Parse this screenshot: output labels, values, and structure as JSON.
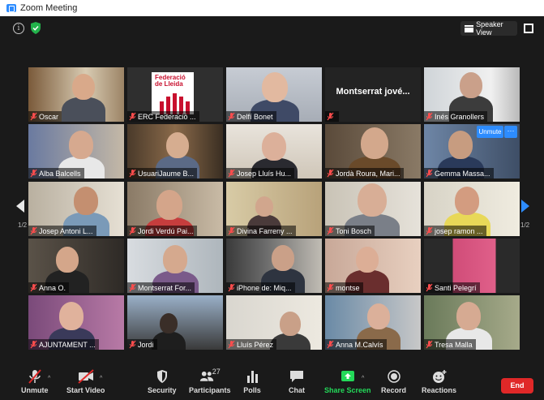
{
  "window": {
    "title": "Zoom Meeting"
  },
  "topbar": {
    "speaker_view_label": "Speaker View"
  },
  "pager": {
    "left_label": "1/2",
    "right_label": "1/2"
  },
  "tiles": [
    {
      "name": "Oscar"
    },
    {
      "name": "ERC Federació ..."
    },
    {
      "name": "Delfí Bonet"
    },
    {
      "name": "",
      "display_text": "Montserrat jové..."
    },
    {
      "name": "Inés Granollers"
    },
    {
      "name": "Alba Balcells"
    },
    {
      "name": "UsuariJaume B..."
    },
    {
      "name": "Josep Lluís Hu..."
    },
    {
      "name": "Jordà Roura, Mari..."
    },
    {
      "name": "Gemma Massa..."
    },
    {
      "name": "Josep Antoni L..."
    },
    {
      "name": "Jordi Verdú Pai..."
    },
    {
      "name": "Divina Farreny ..."
    },
    {
      "name": "Toni Bosch"
    },
    {
      "name": "josep ramon ..."
    },
    {
      "name": "Anna O."
    },
    {
      "name": "Montserrat For..."
    },
    {
      "name": "iPhone de: Miq..."
    },
    {
      "name": "montse"
    },
    {
      "name": "Santi Pelegrí"
    },
    {
      "name": "AJUNTAMENT ..."
    },
    {
      "name": "Jordi"
    },
    {
      "name": "Lluís Pérez"
    },
    {
      "name": "Anna M.Calvís"
    },
    {
      "name": "Tresa  Malla"
    }
  ],
  "federacio_logo": {
    "line1": "Federació",
    "line2": "de Lleida"
  },
  "tile_controls": {
    "unmute_label": "Unmute",
    "more_label": "···"
  },
  "toolbar": {
    "unmute_label": "Unmute",
    "start_video_label": "Start Video",
    "security_label": "Security",
    "participants_label": "Participants",
    "participants_count": "27",
    "polls_label": "Polls",
    "chat_label": "Chat",
    "share_screen_label": "Share Screen",
    "record_label": "Record",
    "reactions_label": "Reactions",
    "end_label": "End"
  },
  "colors": {
    "accent": "#2d8cff",
    "share_green": "#23d959",
    "end_red": "#e02828",
    "active_speaker": "#d4e157"
  }
}
